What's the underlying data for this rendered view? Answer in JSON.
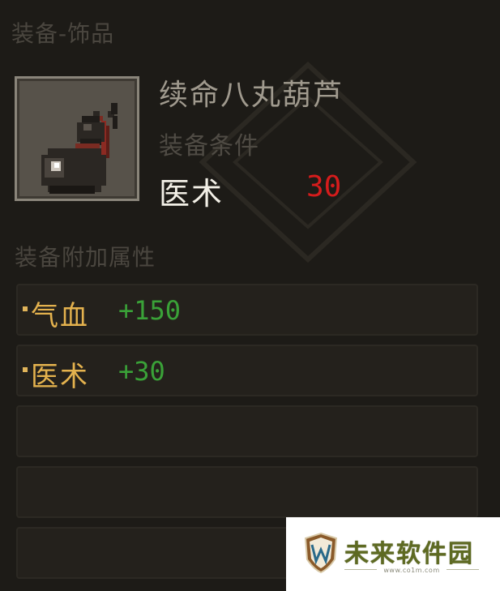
{
  "header": {
    "category_title": "装备-饰品"
  },
  "item": {
    "name": "续命八丸葫芦",
    "icon": "gourd-icon",
    "requirement_label": "装备条件",
    "requirement": {
      "name": "医术",
      "value": "30",
      "value_color": "#d51c1c"
    }
  },
  "attributes": {
    "title": "装备附加属性",
    "slots": [
      {
        "bullet": "·",
        "name": "气血",
        "value": "+150"
      },
      {
        "bullet": "·",
        "name": "医术",
        "value": "+30"
      },
      {
        "bullet": "",
        "name": "",
        "value": ""
      },
      {
        "bullet": "",
        "name": "",
        "value": ""
      },
      {
        "bullet": "",
        "name": "",
        "value": ""
      }
    ],
    "name_color": "#e4b24e",
    "value_color": "#3aa238"
  },
  "watermark": {
    "logo_icon": "w-shield-icon",
    "text": "未来软件园",
    "url": "www.co1m.com"
  }
}
